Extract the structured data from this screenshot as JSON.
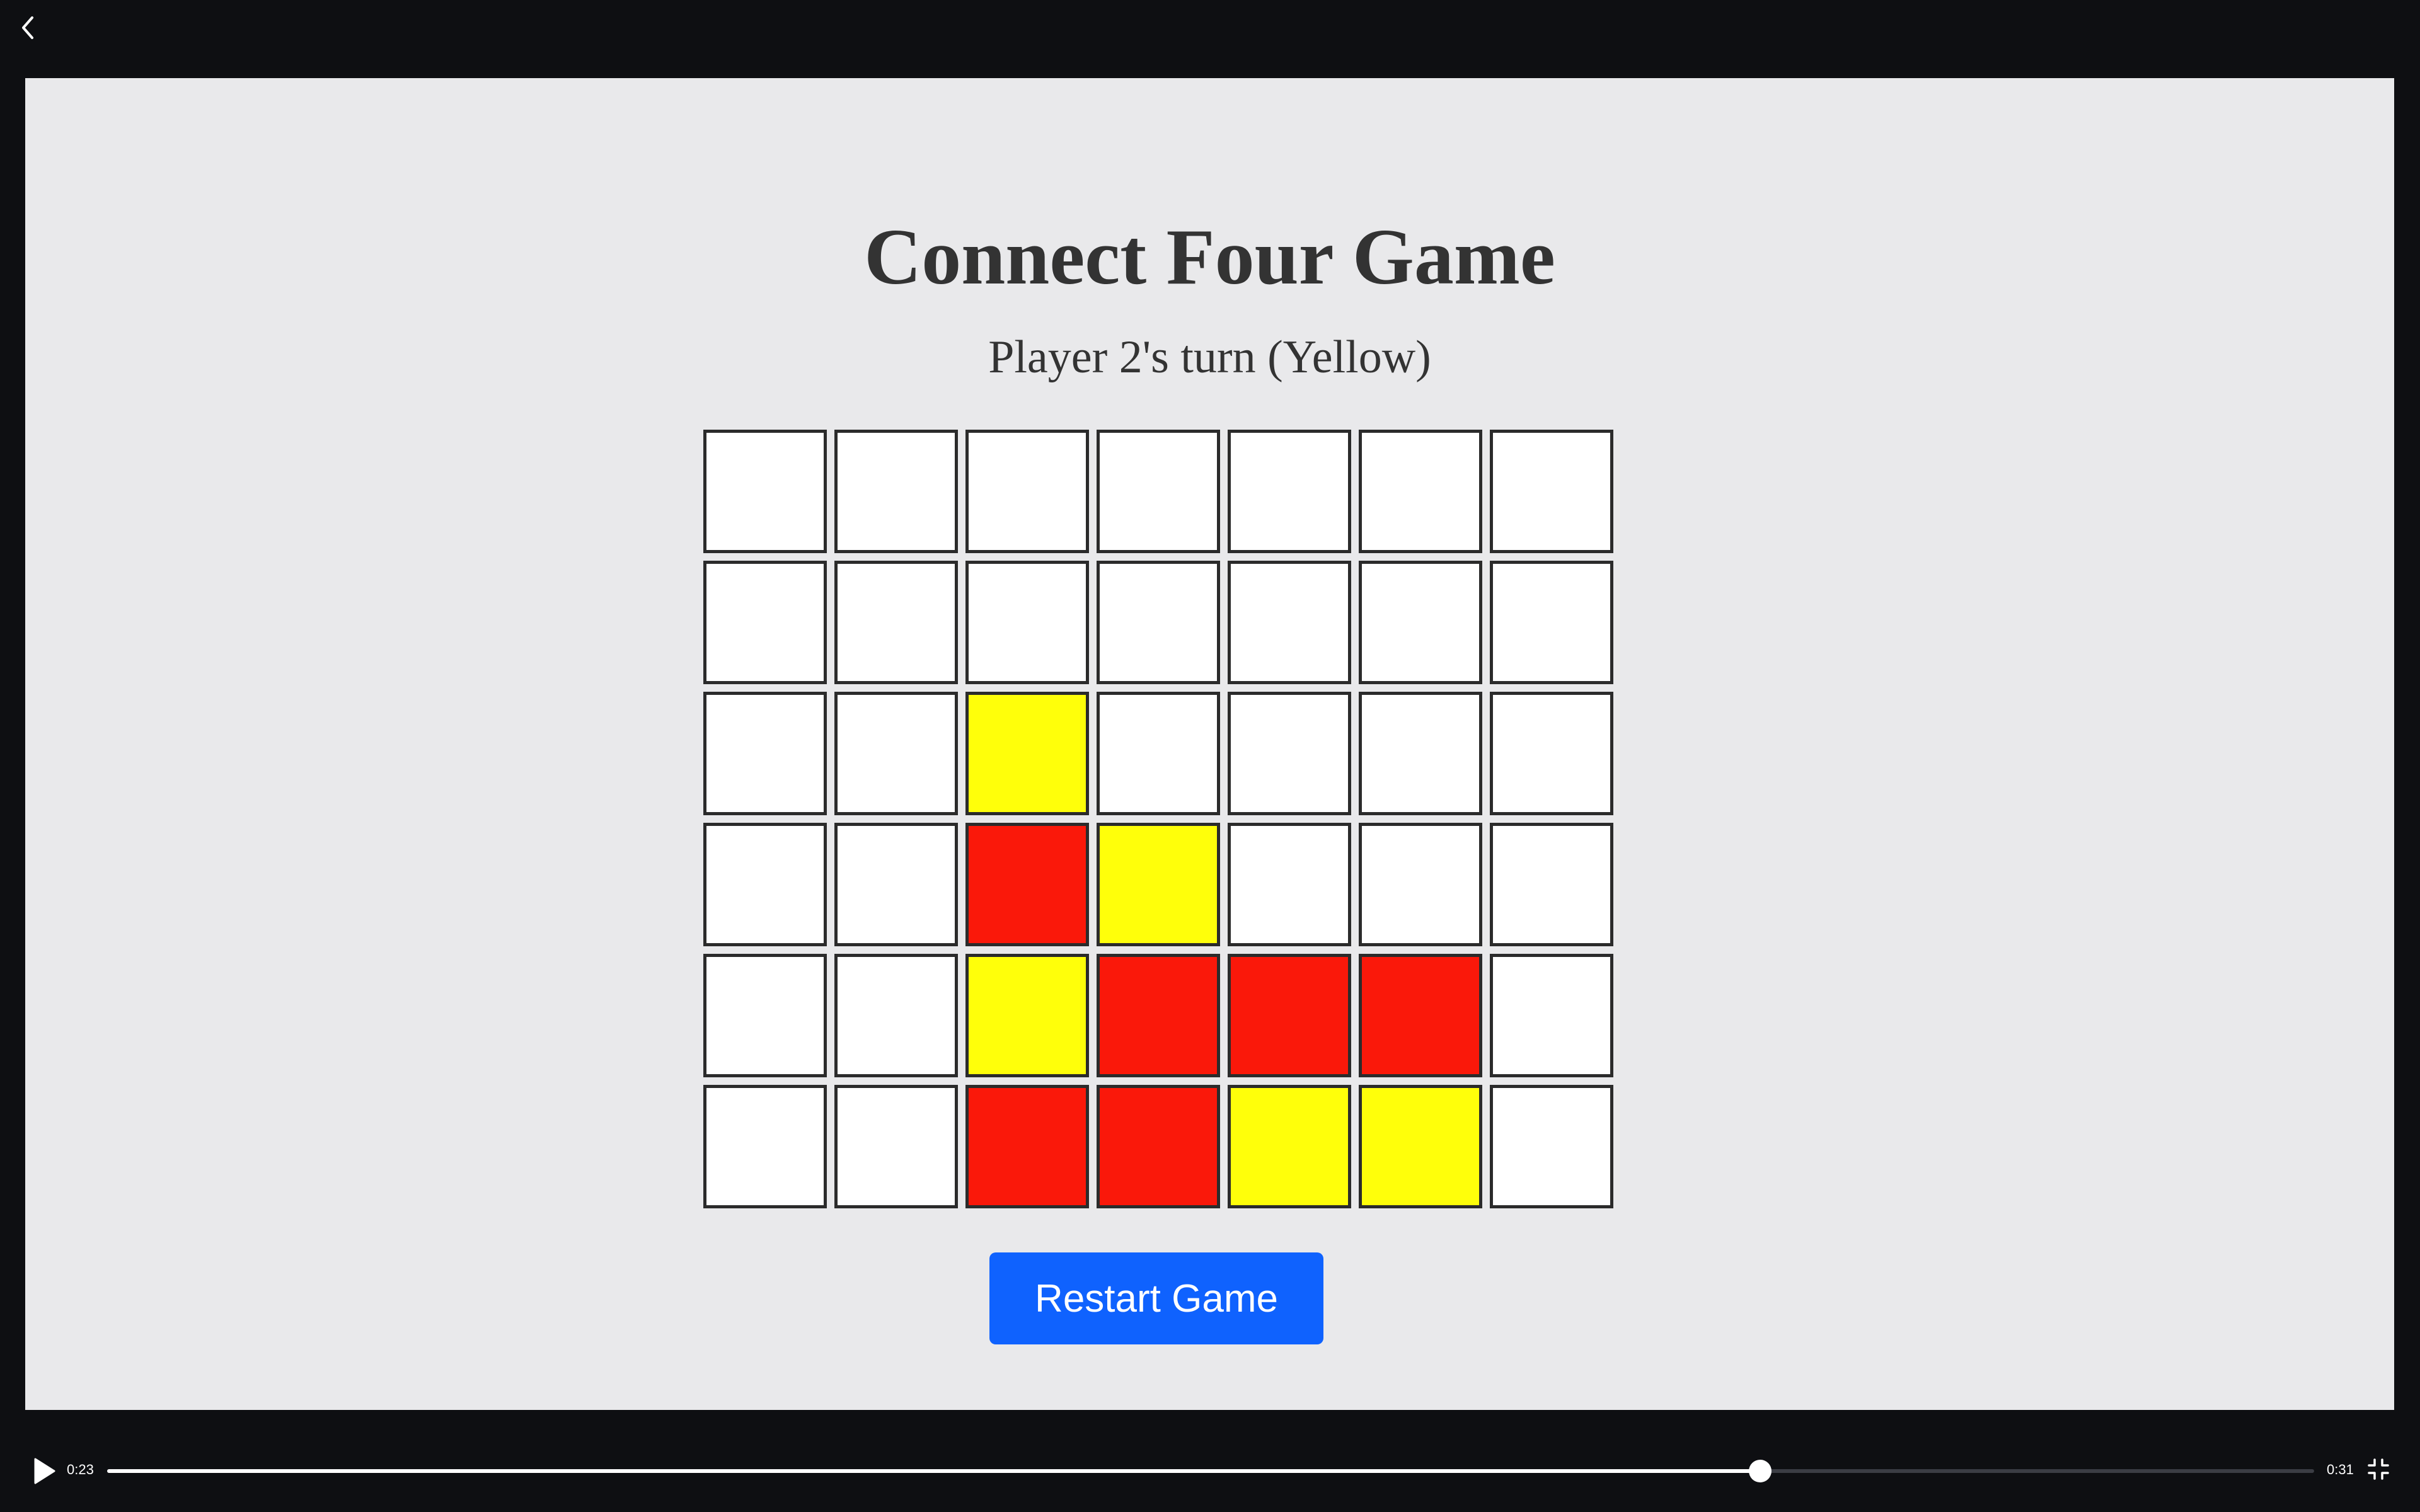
{
  "game": {
    "title": "Connect Four Game",
    "status": "Player 2's turn (Yellow)",
    "restart_label": "Restart Game",
    "colors": {
      "empty": "#ffffff",
      "red": "#fa180a",
      "yellow": "#ffff0a",
      "border": "#2b2b2b",
      "button": "#0f62fe",
      "background": "#e9e9eb"
    },
    "board": [
      [
        "empty",
        "empty",
        "empty",
        "empty",
        "empty",
        "empty",
        "empty"
      ],
      [
        "empty",
        "empty",
        "empty",
        "empty",
        "empty",
        "empty",
        "empty"
      ],
      [
        "empty",
        "empty",
        "yellow",
        "empty",
        "empty",
        "empty",
        "empty"
      ],
      [
        "empty",
        "empty",
        "red",
        "yellow",
        "empty",
        "empty",
        "empty"
      ],
      [
        "empty",
        "empty",
        "yellow",
        "red",
        "red",
        "red",
        "empty"
      ],
      [
        "empty",
        "empty",
        "red",
        "red",
        "yellow",
        "yellow",
        "empty"
      ]
    ]
  },
  "player": {
    "elapsed": "0:23",
    "duration": "0:31",
    "progress": 0.749,
    "icons": {
      "back": "chevron-left-icon",
      "play": "play-icon",
      "fullscreen": "exit-fullscreen-icon"
    }
  }
}
